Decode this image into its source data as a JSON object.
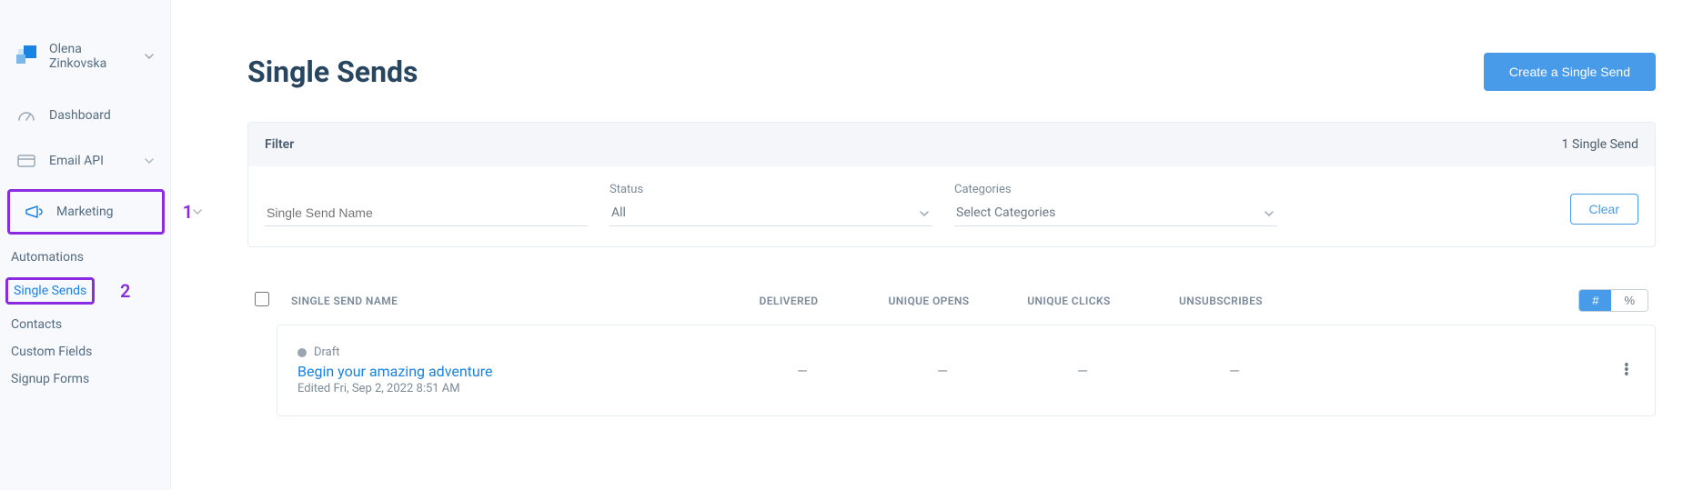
{
  "sidebar": {
    "account_name": "Olena Zinkovska",
    "nav": {
      "dashboard": "Dashboard",
      "email_api": "Email API",
      "marketing": "Marketing",
      "marketing_number": "1"
    },
    "sub": {
      "automations": "Automations",
      "single_sends": "Single Sends",
      "single_sends_number": "2",
      "contacts": "Contacts",
      "custom_fields": "Custom Fields",
      "signup_forms": "Signup Forms"
    }
  },
  "header": {
    "title": "Single Sends",
    "create_btn": "Create a Single Send"
  },
  "filter": {
    "label": "Filter",
    "count": "1 Single Send",
    "name_placeholder": "Single Send Name",
    "status_label": "Status",
    "status_value": "All",
    "categories_label": "Categories",
    "categories_value": "Select Categories",
    "clear_btn": "Clear"
  },
  "table": {
    "headers": {
      "name": "SINGLE SEND NAME",
      "delivered": "DELIVERED",
      "opens": "UNIQUE OPENS",
      "clicks": "UNIQUE CLICKS",
      "unsub": "UNSUBSCRIBES"
    },
    "toggle": {
      "hash": "#",
      "pct": "%"
    }
  },
  "row": {
    "status": "Draft",
    "title": "Begin your amazing adventure",
    "edited": "Edited Fri, Sep 2, 2022 8:51 AM",
    "delivered": "—",
    "opens": "—",
    "clicks": "—",
    "unsub": "—"
  }
}
